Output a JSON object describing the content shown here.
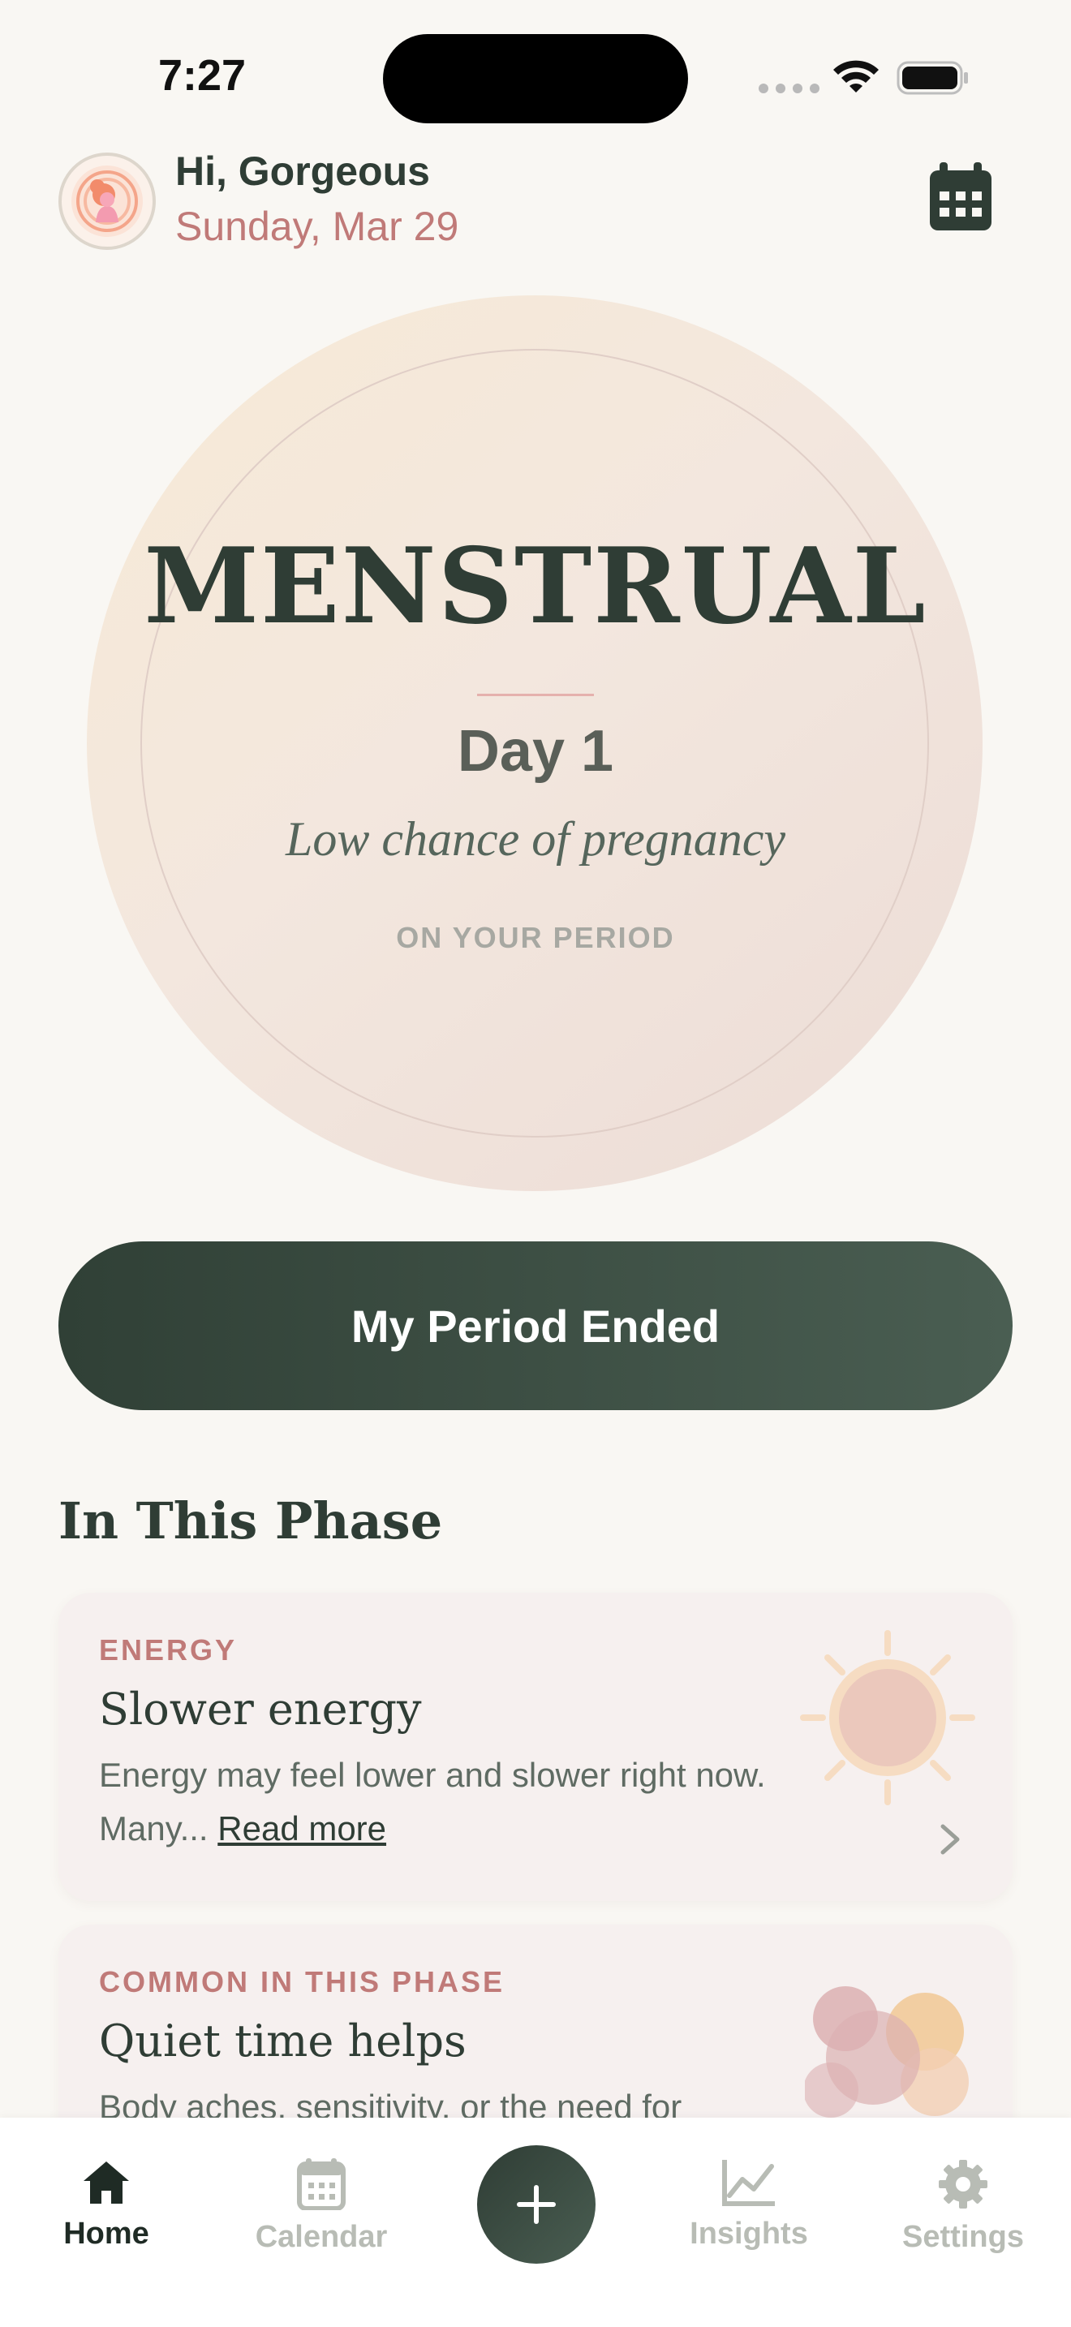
{
  "status_bar": {
    "time": "7:27"
  },
  "header": {
    "greeting": "Hi, Gorgeous",
    "date": "Sunday, Mar 29",
    "avatar_icon": "woman-profile-icon",
    "calendar_icon": "calendar-icon"
  },
  "phase": {
    "name": "MENSTRUAL",
    "day": "Day 1",
    "chance": "Low chance of pregnancy",
    "status": "ON YOUR PERIOD"
  },
  "cta": {
    "label": "My Period Ended"
  },
  "section": {
    "title": "In This Phase"
  },
  "cards": [
    {
      "kicker": "ENERGY",
      "title": "Slower energy",
      "body": "Energy may feel lower and slower right now. Many...",
      "link": "Read more",
      "icon": "sun-icon"
    },
    {
      "kicker": "COMMON IN THIS PHASE",
      "title": "Quiet time helps",
      "body": "Body aches, sensitivity, or the need for",
      "icon": "bubbles-icon"
    }
  ],
  "tabbar": {
    "items": [
      {
        "label": "Home",
        "icon": "home-icon",
        "active": true
      },
      {
        "label": "Calendar",
        "icon": "calendar-icon",
        "active": false
      },
      {
        "label": "Insights",
        "icon": "chart-icon",
        "active": false
      },
      {
        "label": "Settings",
        "icon": "gear-icon",
        "active": false
      }
    ],
    "add_icon": "plus-icon"
  },
  "colors": {
    "background": "#f9f7f3",
    "primary_dark": "#2f3d35",
    "accent_rose": "#c07a78",
    "card_bg": "#f6f0ef"
  }
}
